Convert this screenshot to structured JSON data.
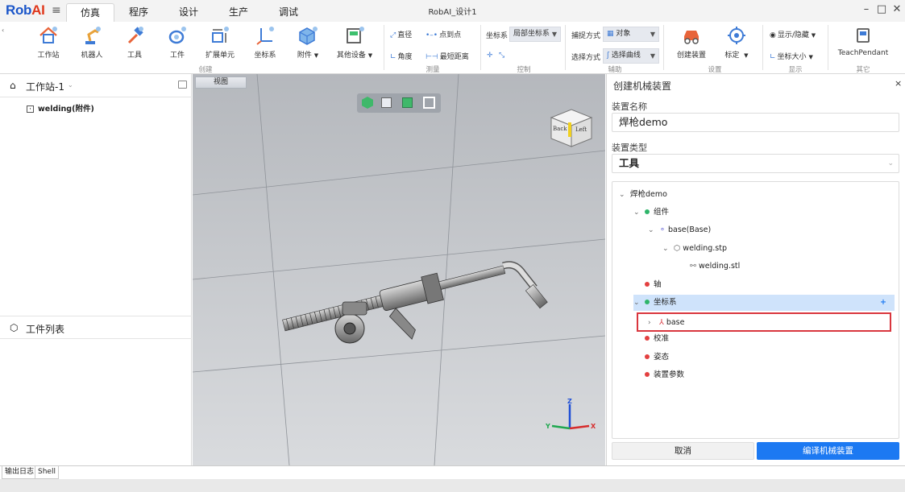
{
  "app": {
    "logo_main": "Rob",
    "logo_accent": "AI",
    "window_title": "RobAI_设计1"
  },
  "menu": {
    "tabs": [
      "仿真",
      "程序",
      "设计",
      "生产",
      "调试"
    ],
    "active": "仿真"
  },
  "window_controls": {
    "minimize": "–",
    "maximize": "□",
    "close": "✕"
  },
  "ribbon": {
    "create": {
      "buttons": [
        "工作站",
        "机器人",
        "工具",
        "工件",
        "扩展单元",
        "坐标系",
        "附件",
        "其他设备"
      ],
      "group_label": "创建"
    },
    "measure": {
      "items": [
        "直径",
        "点到点",
        "角度",
        "最短距离"
      ],
      "group_label": "测量"
    },
    "control": {
      "coord_label": "坐标系",
      "coord_value": "局部坐标系",
      "group_label": "控制"
    },
    "assist": {
      "snap_label": "捕捉方式",
      "snap_value": "对象",
      "select_label": "选择方式",
      "select_value": "选择曲线",
      "group_label": "辅助"
    },
    "settings": {
      "create_device": "创建装置",
      "calibrate": "标定",
      "group_label": "设置"
    },
    "display": {
      "show_hide": "显示/隐藏",
      "coord_size": "坐标大小",
      "group_label": "显示"
    },
    "other": {
      "teach_pendant": "TeachPendant",
      "group_label": "其它"
    }
  },
  "left_panel": {
    "station_title": "工作站-1",
    "tree_item": "welding(附件)",
    "workpiece_title": "工件列表"
  },
  "viewport": {
    "tab": "视图",
    "cube_faces": [
      "Back",
      "Left"
    ],
    "axes": [
      "Z",
      "Y",
      "X"
    ]
  },
  "right_panel": {
    "title": "创建机械装置",
    "close": "×",
    "name_label": "装置名称",
    "name_value": "焊枪demo",
    "type_label": "装置类型",
    "type_value": "工具",
    "tree": {
      "root": "焊枪demo",
      "components": "组件",
      "base": "base(Base)",
      "stp": "welding.stp",
      "stl": "welding.stl",
      "axis": "轴",
      "coordsys": "坐标系",
      "coord_base": "base",
      "calibration": "校准",
      "pose": "姿态",
      "params": "装置参数",
      "add": "+"
    },
    "cancel": "取消",
    "compile": "编译机械装置",
    "colors": {
      "ok": "#2fb56a",
      "error": "#e34040",
      "selected": "#cfe3fb",
      "highlight_border": "#d9363e",
      "primary": "#1c79f2"
    }
  },
  "status": {
    "tabs": [
      "输出日志",
      "Shell"
    ]
  }
}
